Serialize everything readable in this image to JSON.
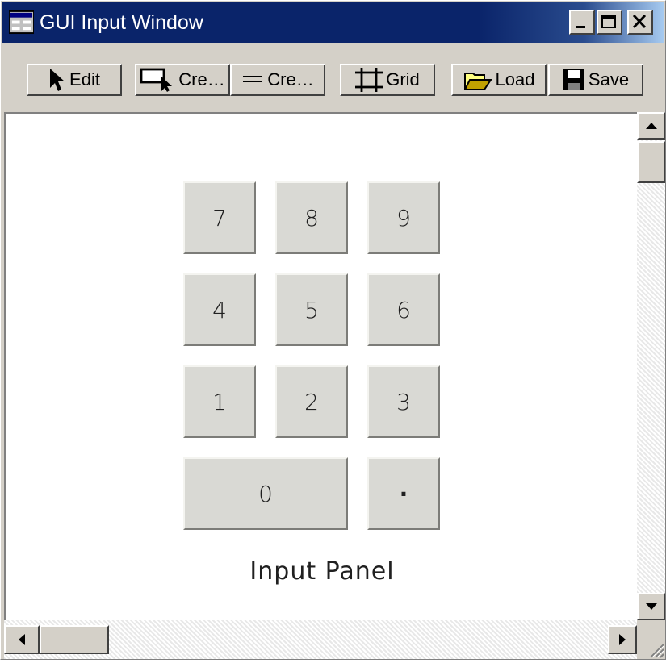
{
  "window": {
    "title": "GUI Input Window",
    "controls": [
      "minimize-icon",
      "maximize-icon",
      "close-icon"
    ]
  },
  "toolbar": {
    "edit_label": "Edit",
    "create_label": "Cre…",
    "create2_label": "Cre…",
    "grid_label": "Grid",
    "load_label": "Load",
    "save_label": "Save"
  },
  "keypad": {
    "keys": [
      "7",
      "8",
      "9",
      "4",
      "5",
      "6",
      "1",
      "2",
      "3",
      "0",
      "·"
    ]
  },
  "panel": {
    "label": "Input Panel"
  },
  "colors": {
    "titlebar": "#0a246a",
    "face": "#d4d0c8",
    "canvas": "#ffffff"
  }
}
